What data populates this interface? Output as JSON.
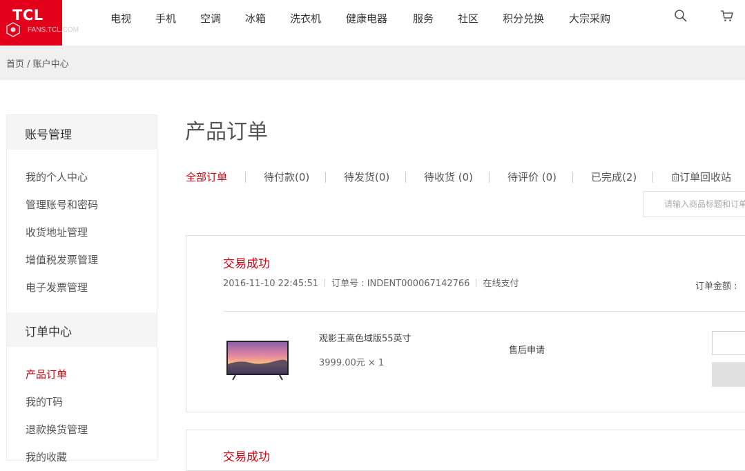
{
  "header": {
    "logo_text": "TCL",
    "logo_sub": "FANS.TCL.COM",
    "nav": [
      "电视",
      "手机",
      "空调",
      "冰箱",
      "洗衣机",
      "健康电器",
      "服务",
      "社区",
      "积分兑换",
      "大宗采购"
    ],
    "icons": [
      "search-icon",
      "cart-icon"
    ]
  },
  "breadcrumb": {
    "home": "首页",
    "separator": " / ",
    "current": "账户中心"
  },
  "sidebar": {
    "account_title": "账号管理",
    "account_items": [
      "我的个人中心",
      "管理账号和密码",
      "收货地址管理",
      "增值税发票管理",
      "电子发票管理"
    ],
    "order_title": "订单中心",
    "order_items": [
      "产品订单",
      "我的T码",
      "退款换货管理",
      "我的收藏"
    ],
    "active": "产品订单"
  },
  "main": {
    "title": "产品订单",
    "tabs": [
      "全部订单",
      "待付款(0)",
      "待发货(0)",
      "待收货 (0)",
      "待评价 (0)",
      "已完成(2)",
      "订单回收站"
    ],
    "active_tab": "全部订单",
    "search_placeholder": "请输入商品标题和订单号"
  },
  "orders": [
    {
      "status": "交易成功",
      "date": "2016-11-10 22:45:51",
      "order_no_label": "订单号 : INDENT000067142766",
      "pay_method": "在线支付",
      "amount_label": "订单金额 : ",
      "product_name": "观影王高色域版55英寸",
      "price": "3999.00元 × 1",
      "after_sale": "售后申请"
    },
    {
      "status": "交易成功"
    }
  ],
  "colors": {
    "brand_red": "#e3001b",
    "accent_red": "#d7000f",
    "breadcrumb_bg": "#f0f0f0"
  }
}
